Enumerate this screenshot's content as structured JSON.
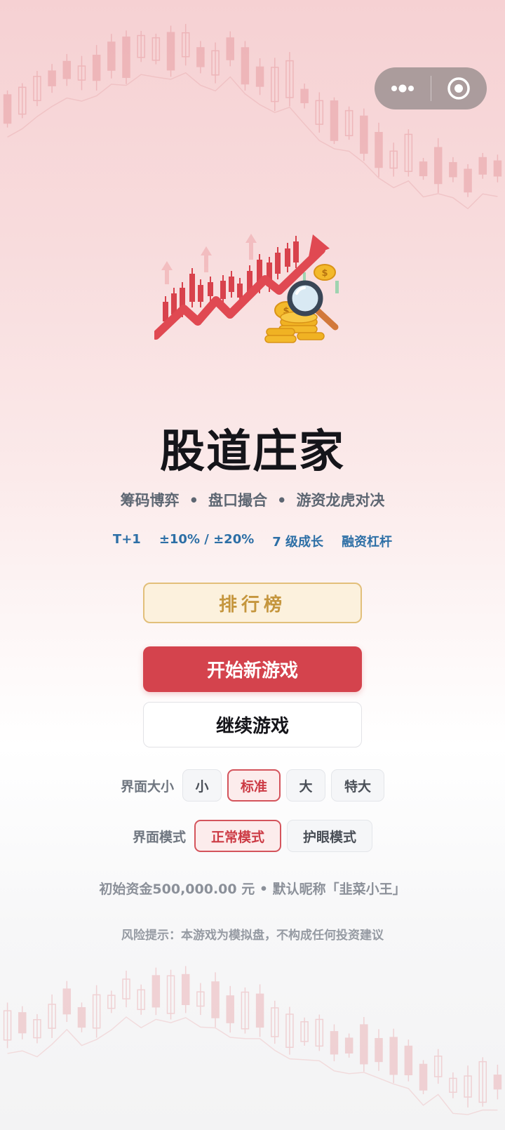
{
  "app": {
    "title": "股道庄家",
    "subtitle_parts": [
      "筹码博弈",
      "盘口撮合",
      "游资龙虎对决"
    ],
    "subtitle_separator": "•",
    "features": [
      "T+1",
      "±10% / ±20%",
      "7 级成长",
      "融资杠杆"
    ]
  },
  "buttons": {
    "leaderboard": "排行榜",
    "new_game": "开始新游戏",
    "continue_game": "继续游戏"
  },
  "settings": {
    "size_label": "界面大小",
    "size_options": [
      "小",
      "标准",
      "大",
      "特大"
    ],
    "size_selected": "标准",
    "mode_label": "界面模式",
    "mode_options": [
      "正常模式",
      "护眼模式"
    ],
    "mode_selected": "正常模式"
  },
  "info": {
    "capital_line": "初始资金500,000.00 元 • 默认昵称「韭菜小王」",
    "risk_notice": "风险提示：本游戏为模拟盘，不构成任何投资建议"
  },
  "capsule": {
    "more_icon": "more-dots-icon",
    "close_icon": "target-circle-icon"
  },
  "hero": {
    "icon": "stock-chart-rising-arrow-magnifier-coins-icon"
  },
  "colors": {
    "accent_red": "#d4434d",
    "gold": "#c5963e",
    "feature_blue": "#2d6fa6",
    "title": "#15151a"
  }
}
